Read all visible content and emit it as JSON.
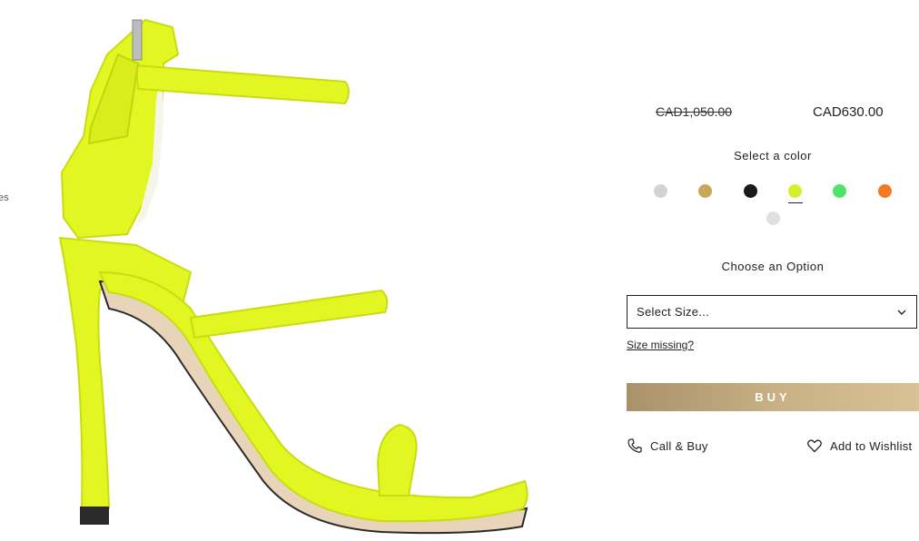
{
  "side_text": "es",
  "product": {
    "name": "",
    "image_colors": {
      "body": "#e2f721",
      "shade": "#c9dc13",
      "sole": "#e8d4b8",
      "tip": "#2a2a2a"
    }
  },
  "pricing": {
    "original_price": "CAD1,050.00",
    "sale_price": "CAD630.00"
  },
  "color_selector": {
    "heading": "Select a color",
    "swatches": [
      {
        "name": "silver",
        "color": "#d3d3d3",
        "selected": false
      },
      {
        "name": "gold",
        "color": "#c9a85a",
        "selected": false
      },
      {
        "name": "black",
        "color": "#1a1a1a",
        "selected": false
      },
      {
        "name": "neon-yellow",
        "color": "#d6ee2c",
        "selected": true
      },
      {
        "name": "green",
        "color": "#4fe36c",
        "selected": false
      },
      {
        "name": "orange",
        "color": "#f47a25",
        "selected": false
      },
      {
        "name": "light-grey",
        "color": "#e0e0e0",
        "selected": false
      }
    ]
  },
  "size_selector": {
    "heading": "Choose an Option",
    "value": "Select Size...",
    "size_missing_link": "Size missing?"
  },
  "buy_button": {
    "label": "BUY"
  },
  "actions": {
    "call_label": "Call & Buy",
    "wishlist_label": "Add to Wishlist"
  }
}
